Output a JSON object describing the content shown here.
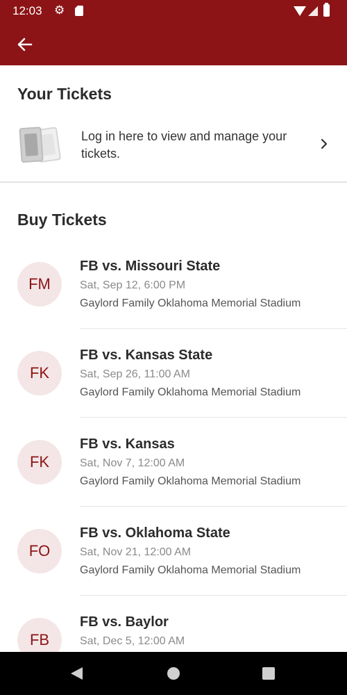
{
  "status_bar": {
    "time": "12:03"
  },
  "app_bar": {
    "back_icon": "arrow-left-icon"
  },
  "your_tickets": {
    "title": "Your Tickets",
    "login_text": "Log in here to view and manage your tickets."
  },
  "buy_tickets": {
    "title": "Buy Tickets",
    "events": [
      {
        "initials": "FM",
        "title": "FB vs. Missouri State",
        "date": "Sat, Sep 12, 6:00 PM",
        "venue": "Gaylord Family Oklahoma Memorial Stadium"
      },
      {
        "initials": "FK",
        "title": "FB vs. Kansas State",
        "date": "Sat, Sep 26, 11:00 AM",
        "venue": "Gaylord Family Oklahoma Memorial Stadium"
      },
      {
        "initials": "FK",
        "title": "FB vs. Kansas",
        "date": "Sat, Nov 7, 12:00 AM",
        "venue": "Gaylord Family Oklahoma Memorial Stadium"
      },
      {
        "initials": "FO",
        "title": "FB vs. Oklahoma State",
        "date": "Sat, Nov 21, 12:00 AM",
        "venue": "Gaylord Family Oklahoma Memorial Stadium"
      },
      {
        "initials": "FB",
        "title": "FB vs. Baylor",
        "date": "Sat, Dec 5, 12:00 AM",
        "venue": ""
      }
    ]
  },
  "colors": {
    "primary": "#8c1416",
    "avatar_bg": "#f4e6e6"
  }
}
